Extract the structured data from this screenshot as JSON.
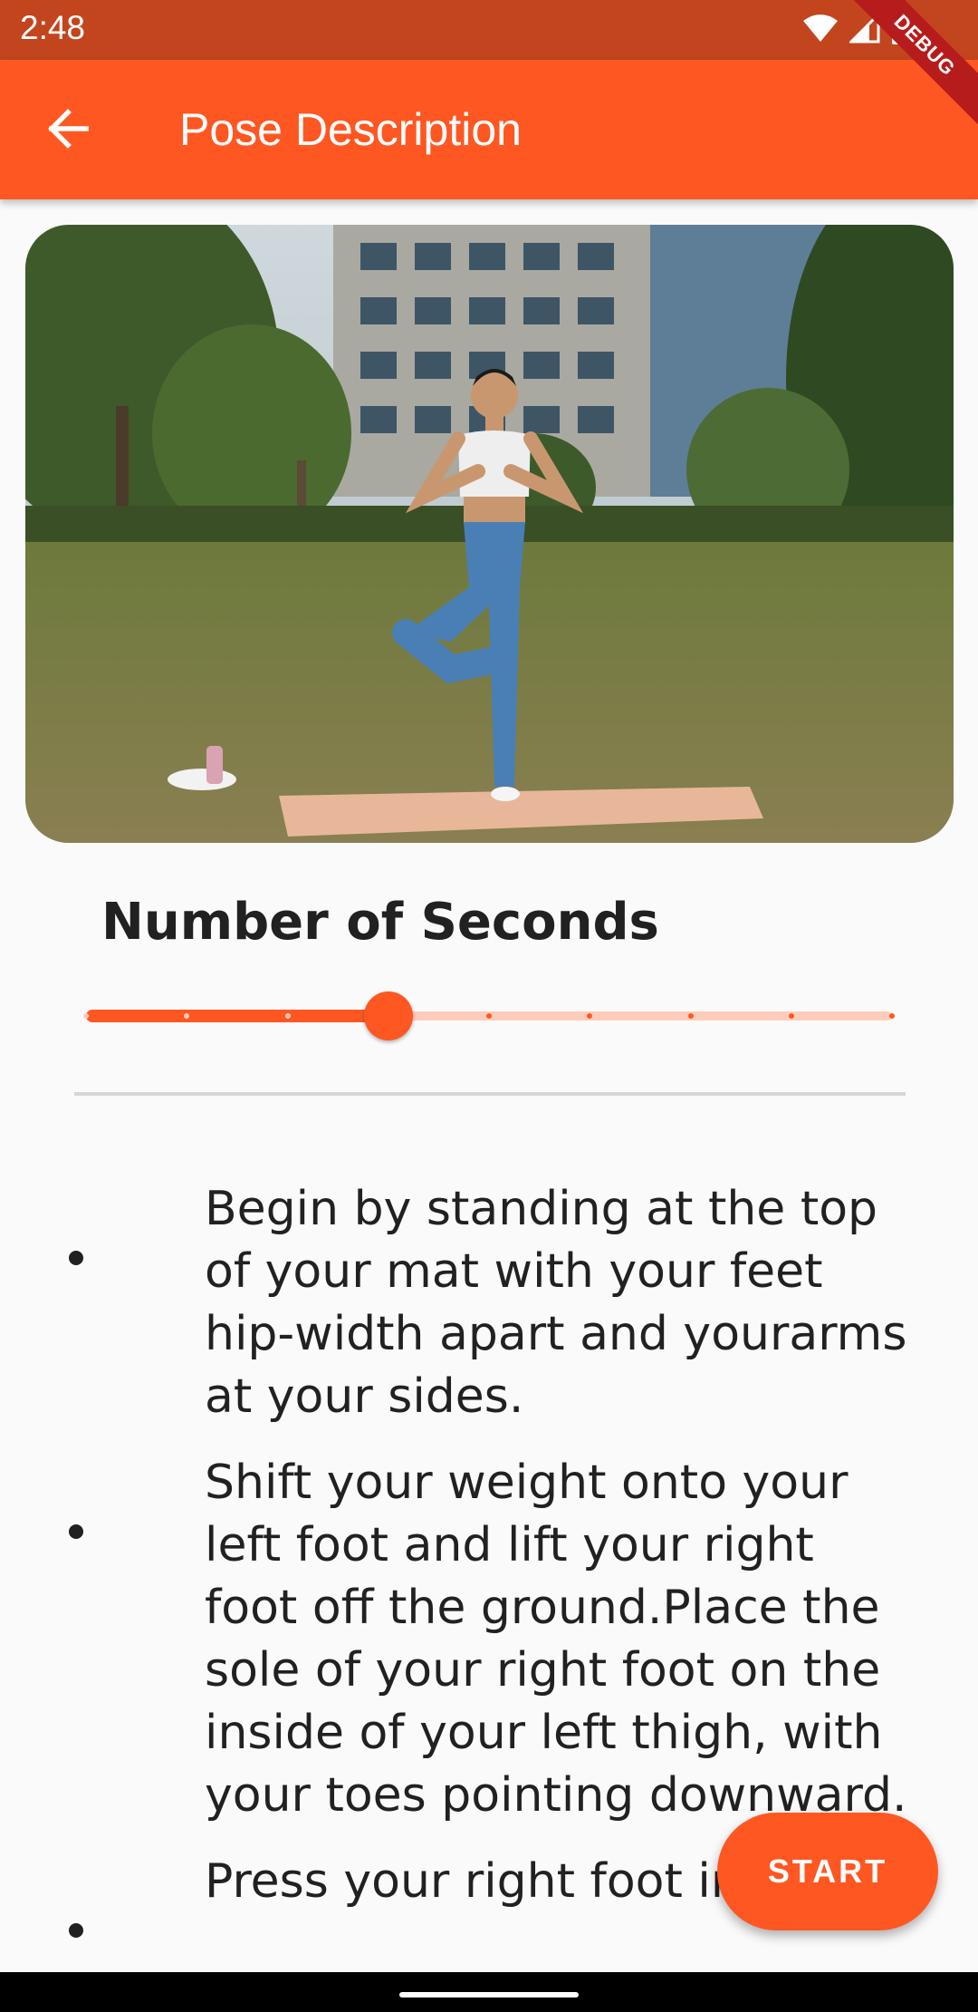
{
  "status_bar": {
    "time": "2:48",
    "debug_label": "DEBUG",
    "icons": [
      "wifi-icon",
      "cell-signal-icon",
      "battery-icon"
    ]
  },
  "app_bar": {
    "title": "Pose Description",
    "back_icon": "arrow-back-icon"
  },
  "pose_image": {
    "subject": "woman in tree pose on yoga mat in park"
  },
  "seconds": {
    "heading": "Number of Seconds",
    "slider_divisions": 8,
    "slider_value_fraction": 0.375
  },
  "steps": [
    "Begin by standing at the top of your mat with your feet hip-width apart and yourarms at your sides.",
    "Shift your weight onto your left foot and lift your right foot off the ground.Place the sole of your right foot on the inside of your left thigh, with your toes pointing downward.",
    "Press your right foot into"
  ],
  "fab": {
    "label": "START"
  },
  "colors": {
    "accent": "#ff5722",
    "status_bar": "#c2451e",
    "slider_inactive": "#ffccbc",
    "background": "#fafafa"
  }
}
